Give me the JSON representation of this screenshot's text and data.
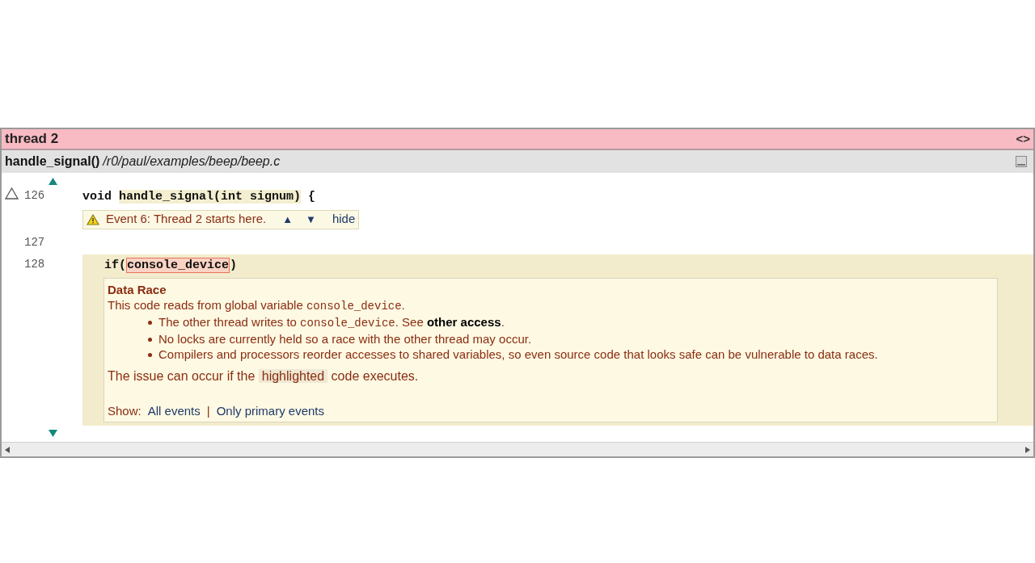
{
  "panel": {
    "title": "thread 2",
    "nav_symbol": "<>"
  },
  "location": {
    "function": "handle_signal()",
    "path": "/r0/paul/examples/beep/beep.c"
  },
  "lines": [
    {
      "number": "126",
      "marker": true,
      "current": false,
      "segments": [
        {
          "kind": "plain",
          "text": "void "
        },
        {
          "kind": "highlight",
          "text": "handle_signal(int signum)"
        },
        {
          "kind": "plain",
          "text": " {"
        }
      ],
      "event": {
        "text": "Event 6:  Thread 2 starts here.",
        "prev": "▲",
        "next": "▼",
        "hide": "hide"
      }
    },
    {
      "number": "127",
      "marker": false,
      "current": false
    },
    {
      "number": "128",
      "marker": false,
      "current": true,
      "segments": [
        {
          "kind": "plain",
          "text": "if("
        },
        {
          "kind": "boxed",
          "text": "console_device"
        },
        {
          "kind": "plain",
          "text": ")"
        }
      ]
    }
  ],
  "issue": {
    "title": "Data Race",
    "intro": [
      {
        "kind": "plain",
        "text": "This code reads from global variable "
      },
      {
        "kind": "code",
        "text": "console_device"
      },
      {
        "kind": "plain",
        "text": "."
      }
    ],
    "bullets": [
      [
        {
          "kind": "plain",
          "text": "The other thread writes to "
        },
        {
          "kind": "code",
          "text": "console_device"
        },
        {
          "kind": "plain",
          "text": ".  See "
        },
        {
          "kind": "link",
          "text": "other access"
        },
        {
          "kind": "plain",
          "text": "."
        }
      ],
      [
        {
          "kind": "plain",
          "text": "No locks are currently held so a race with the other thread may occur."
        }
      ],
      [
        {
          "kind": "plain",
          "text": "Compilers and processors reorder accesses to shared variables, so even source code that looks safe can be vulnerable to data races."
        }
      ]
    ],
    "condition": [
      {
        "kind": "plain",
        "text": "The issue can occur if the "
      },
      {
        "kind": "highlight",
        "text": "highlighted"
      },
      {
        "kind": "plain",
        "text": " code executes."
      }
    ],
    "show_label": "Show:",
    "show_options": [
      {
        "label": "All events",
        "selected": false
      },
      {
        "label": "Only primary events",
        "selected": false
      }
    ],
    "separator": "|"
  }
}
